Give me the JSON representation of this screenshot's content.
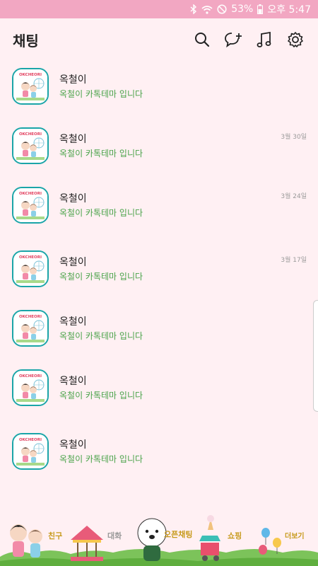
{
  "status": {
    "battery": "53%",
    "time": "오후 5:47"
  },
  "header": {
    "title": "채팅"
  },
  "chats": [
    {
      "name": "옥철이",
      "message": "옥철이 카톡테마 입니다",
      "time": ""
    },
    {
      "name": "옥철이",
      "message": "옥철이 카톡테마 입니다",
      "time": "3월 30일"
    },
    {
      "name": "옥철이",
      "message": "옥철이 카톡테마 입니다",
      "time": "3월 24일"
    },
    {
      "name": "옥철이",
      "message": "옥철이 카톡테마 입니다",
      "time": "3월 17일"
    },
    {
      "name": "옥철이",
      "message": "옥철이 카톡테마 입니다",
      "time": ""
    },
    {
      "name": "옥철이",
      "message": "옥철이 카톡테마 입니다",
      "time": ""
    },
    {
      "name": "옥철이",
      "message": "옥철이 카톡테마 입니다",
      "time": ""
    }
  ],
  "avatar_text": "OKCHEORI",
  "tabs": {
    "friends": "친구",
    "chats": "대화",
    "openchat": "오픈채팅",
    "shopping": "쇼핑",
    "more": "더보기"
  },
  "colors": {
    "status_bar": "#f2a7c2",
    "accent": "#1aa5a8",
    "message": "#4aa34a",
    "background": "#fff0f3"
  }
}
